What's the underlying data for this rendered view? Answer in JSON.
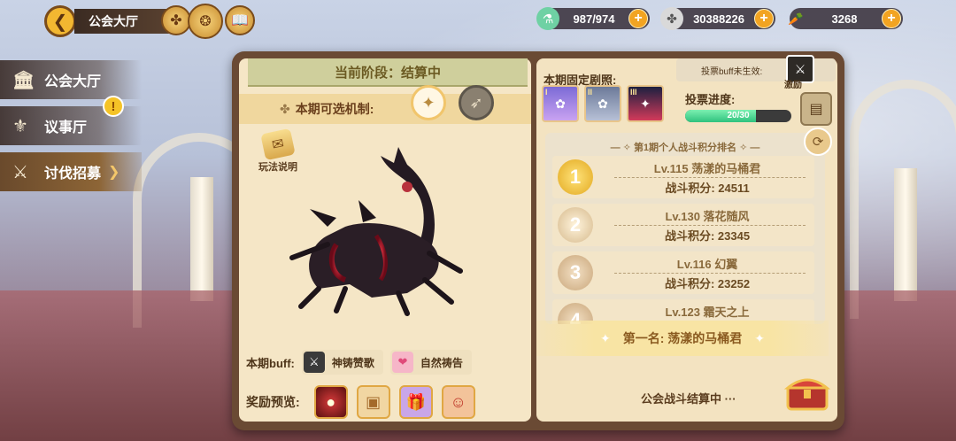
{
  "header": {
    "title": "公会大厅",
    "back_icon": "back-icon",
    "resources": [
      {
        "name": "stamina",
        "icon": "potion-icon",
        "value": "987/974"
      },
      {
        "name": "coins",
        "icon": "clover-coin-icon",
        "value": "30388226"
      },
      {
        "name": "carrots",
        "icon": "carrot-icon",
        "value": "3268"
      }
    ]
  },
  "sidebar": {
    "items": [
      {
        "label": "公会大厅",
        "icon": "bank-icon"
      },
      {
        "label": "议事厅",
        "icon": "meeting-icon",
        "badge": "!"
      },
      {
        "label": "讨伐招募",
        "icon": "sword-icon",
        "active": true
      }
    ]
  },
  "left_page": {
    "stage": "当前阶段：结算中",
    "mechanism_label": "本期可选机制:",
    "rules_label": "玩法说明",
    "buff_label": "本期buff:",
    "buffs": [
      {
        "label": "神铸赞歌",
        "icon": "sword-buff-icon"
      },
      {
        "label": "自然祷告",
        "icon": "heart-buff-icon"
      }
    ],
    "reward_label": "奖励预览:"
  },
  "right_page": {
    "fixed_label": "本期固定剧照:",
    "fixed_ranks": [
      "I",
      "II",
      "III"
    ],
    "vote_effect_label": "投票buff未生效:",
    "vote_icon_label": "激励",
    "vote_progress_label": "投票进度:",
    "vote_progress_text": "20/30",
    "vote_progress_fraction": 0.667,
    "ranking_title": "第1期个人战斗积分排名",
    "rankings": [
      {
        "rank": "1",
        "name": "Lv.115 荡漾的马桶君",
        "score": "战斗积分: 24511"
      },
      {
        "rank": "2",
        "name": "Lv.130 落花随风",
        "score": "战斗积分: 23345"
      },
      {
        "rank": "3",
        "name": "Lv.116 幻翼",
        "score": "战斗积分: 23252"
      },
      {
        "rank": "4",
        "name": "Lv.123 霜天之上",
        "score": ""
      }
    ],
    "first_place": "第一名: 荡漾的马桶君",
    "settle_text": "公会战斗结算中 ···"
  },
  "colors": {
    "accent_gold": "#f2b731",
    "book_brown": "#6a4a34",
    "vote_green": "#2fc27e"
  }
}
